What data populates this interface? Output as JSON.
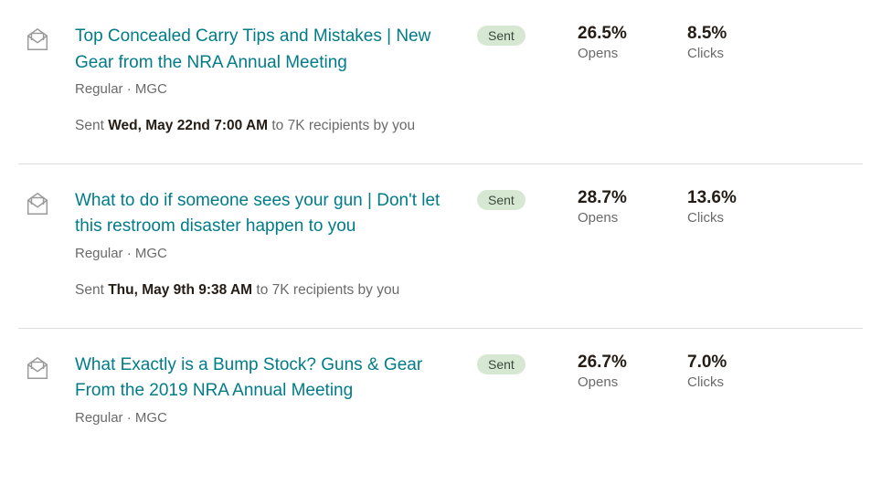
{
  "status_label": "Sent",
  "opens_label": "Opens",
  "clicks_label": "Clicks",
  "sent_prefix": "Sent ",
  "campaigns": [
    {
      "title": "Top Concealed Carry Tips and Mistakes | New Gear from the NRA Annual Meeting",
      "type_line": "Regular · MGC",
      "sent_when": "Wed, May 22nd 7:00 AM",
      "sent_suffix": " to 7K recipients by you",
      "opens": "26.5%",
      "clicks": "8.5%"
    },
    {
      "title": "What to do if someone sees your gun | Don't let this restroom disaster happen to you",
      "type_line": "Regular · MGC",
      "sent_when": "Thu, May 9th 9:38 AM",
      "sent_suffix": " to 7K recipients by you",
      "opens": "28.7%",
      "clicks": "13.6%"
    },
    {
      "title": "What Exactly is a Bump Stock? Guns & Gear From the 2019 NRA Annual Meeting",
      "type_line": "Regular · MGC",
      "sent_when": "",
      "sent_suffix": "",
      "opens": "26.7%",
      "clicks": "7.0%"
    }
  ]
}
